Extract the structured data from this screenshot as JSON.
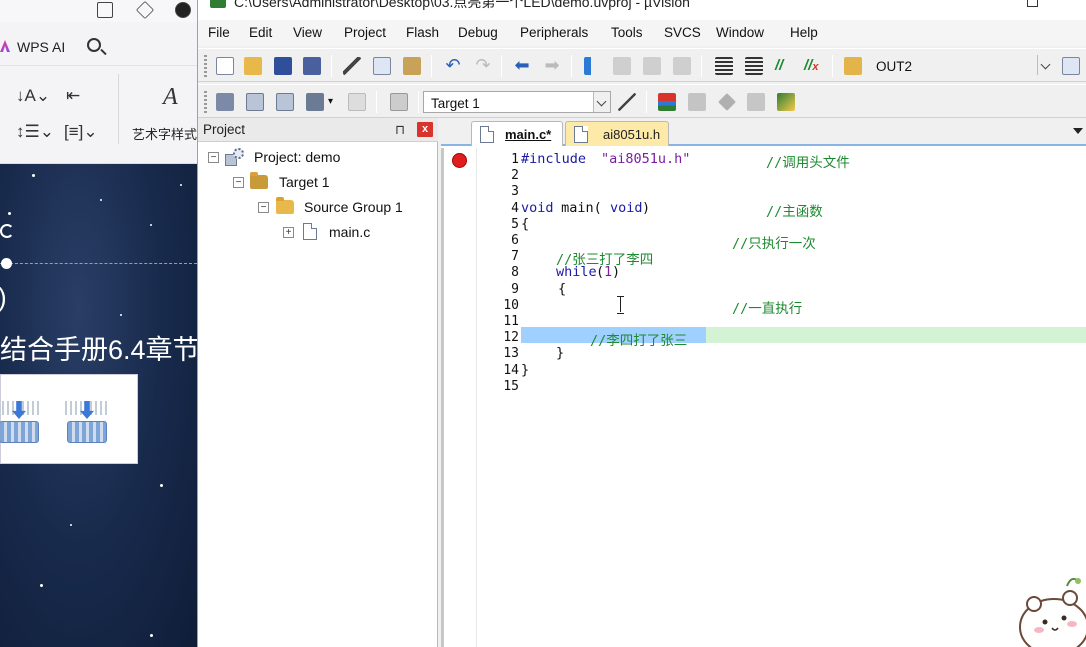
{
  "wps": {
    "ai_label": "WPS AI",
    "art_label": "艺术字样式",
    "slide_title": "结合手册6.4章节",
    "paren": ")"
  },
  "window": {
    "title": "C:\\Users\\Administrator\\Desktop\\03.点亮第一个LED\\demo.uvproj - µVision"
  },
  "menu": [
    "File",
    "Edit",
    "View",
    "Project",
    "Flash",
    "Debug",
    "Peripherals",
    "Tools",
    "SVCS",
    "Window",
    "Help"
  ],
  "toolbar1": {
    "combo_value": "OUT2"
  },
  "toolbar2": {
    "target_value": "Target 1"
  },
  "project_panel": {
    "title": "Project",
    "pin": "⊓",
    "close": "x",
    "tree": {
      "root": "Project: demo",
      "target": "Target 1",
      "group": "Source Group 1",
      "file": "main.c"
    }
  },
  "editor": {
    "tabs": [
      {
        "name": "main.c*",
        "active": true
      },
      {
        "name": "ai8051u.h",
        "active": false
      }
    ],
    "line_numbers": [
      "1",
      "2",
      "3",
      "4",
      "5",
      "6",
      "7",
      "8",
      "9",
      "10",
      "11",
      "12",
      "13",
      "14",
      "15"
    ],
    "lines": {
      "l1_include": "#include",
      "l1_file": "\"ai8051u.h\"",
      "l1_comment": "//调用头文件",
      "l4_void": "void",
      "l4_main": " main(",
      "l4_void2": "void",
      "l4_close": ")",
      "l4_comment": "//主函数",
      "l5": "{",
      "l6_comment": "//只执行一次",
      "l7_comment": "//张三打了李四",
      "l8_while": "while",
      "l8_open": "(",
      "l8_one": "1",
      "l8_close": ")",
      "l9": "{",
      "l10_comment": "//一直执行",
      "l12_comment": "//李四打了张三",
      "l13": "}",
      "l14": "}"
    },
    "highlight_color": "#9fd0ff",
    "current_line_color": "#d4f2d4"
  }
}
